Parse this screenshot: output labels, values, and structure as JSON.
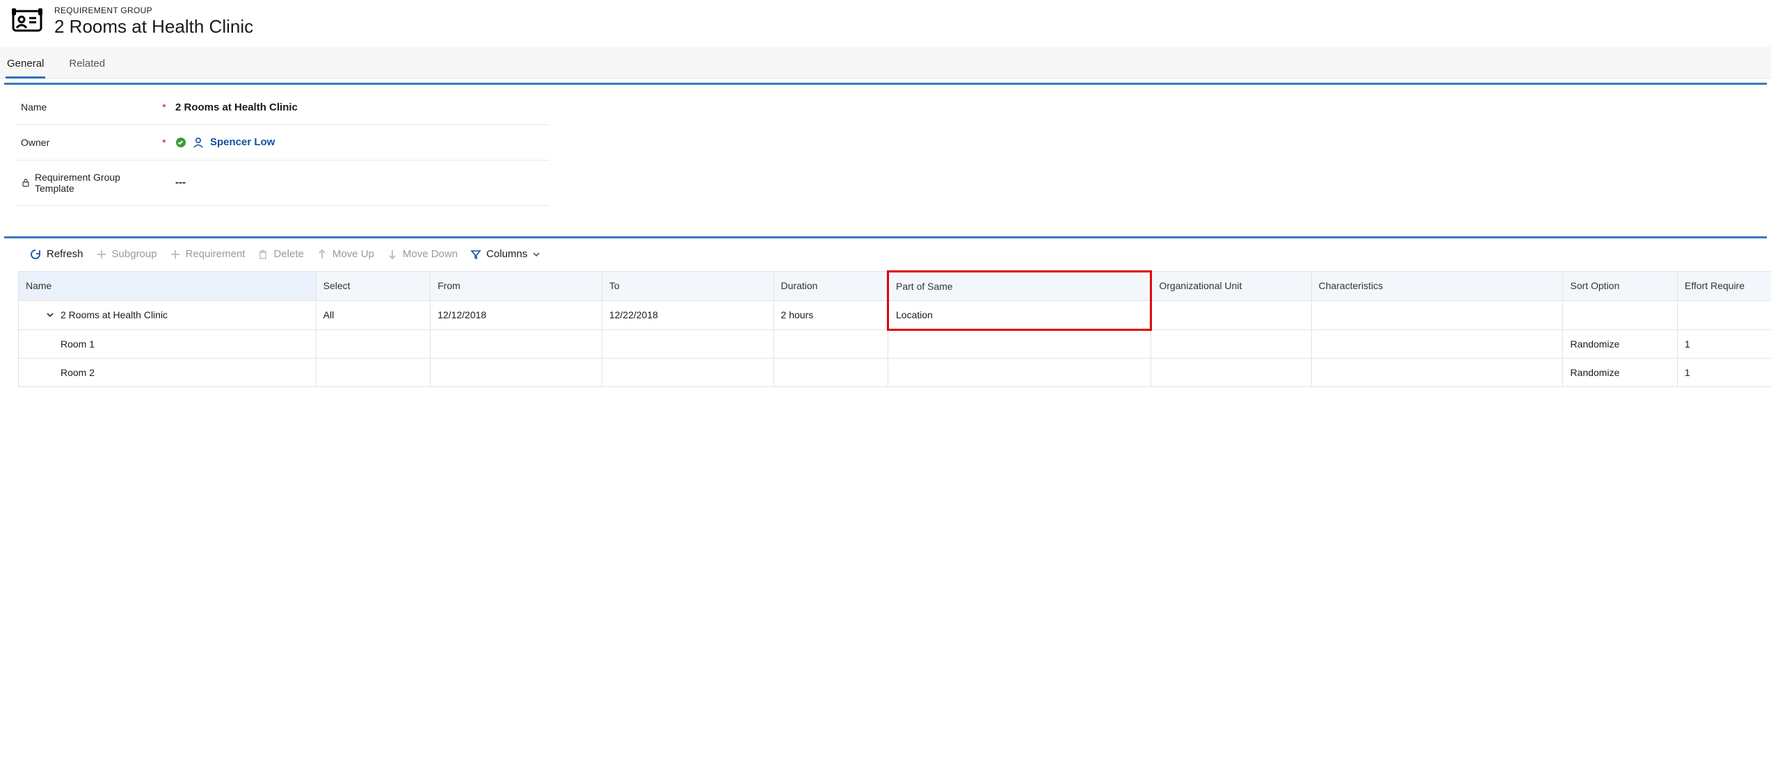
{
  "header": {
    "supertitle": "REQUIREMENT GROUP",
    "title": "2 Rooms at Health Clinic"
  },
  "tabs": {
    "general": "General",
    "related": "Related"
  },
  "form": {
    "name_label": "Name",
    "name_value": "2 Rooms at Health Clinic",
    "owner_label": "Owner",
    "owner_value": "Spencer Low",
    "template_label": "Requirement Group Template",
    "template_value": "---"
  },
  "toolbar": {
    "refresh": "Refresh",
    "subgroup": "Subgroup",
    "requirement": "Requirement",
    "delete": "Delete",
    "moveup": "Move Up",
    "movedown": "Move Down",
    "columns": "Columns"
  },
  "grid": {
    "headers": {
      "name": "Name",
      "select": "Select",
      "from": "From",
      "to": "To",
      "duration": "Duration",
      "partofsame": "Part of Same",
      "orgunit": "Organizational Unit",
      "characteristics": "Characteristics",
      "sortoption": "Sort Option",
      "effortreq": "Effort Require"
    },
    "rows": [
      {
        "name": "2 Rooms at Health Clinic",
        "select": "All",
        "from": "12/12/2018",
        "to": "12/22/2018",
        "duration": "2 hours",
        "partofsame": "Location",
        "orgunit": "",
        "characteristics": "",
        "sortoption": "",
        "effortreq": ""
      },
      {
        "name": "Room 1",
        "select": "",
        "from": "",
        "to": "",
        "duration": "",
        "partofsame": "",
        "orgunit": "",
        "characteristics": "",
        "sortoption": "Randomize",
        "effortreq": "1"
      },
      {
        "name": "Room 2",
        "select": "",
        "from": "",
        "to": "",
        "duration": "",
        "partofsame": "",
        "orgunit": "",
        "characteristics": "",
        "sortoption": "Randomize",
        "effortreq": "1"
      }
    ]
  }
}
